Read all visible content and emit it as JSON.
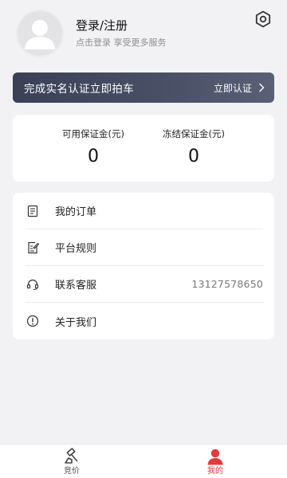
{
  "profile": {
    "title": "登录/注册",
    "subtitle": "点击登录 享受更多服务"
  },
  "verify_banner": {
    "title": "完成实名认证立即拍车",
    "action": "立即认证"
  },
  "deposit": {
    "available_label": "可用保证金(元)",
    "available_value": "0",
    "frozen_label": "冻结保证金(元)",
    "frozen_value": "0"
  },
  "menu": {
    "items": [
      {
        "label": "我的订单",
        "icon": "order-list-icon",
        "value": ""
      },
      {
        "label": "平台规则",
        "icon": "rules-edit-icon",
        "value": ""
      },
      {
        "label": "联系客服",
        "icon": "headset-icon",
        "value": "13127578650"
      },
      {
        "label": "关于我们",
        "icon": "info-icon",
        "value": ""
      }
    ]
  },
  "tabbar": {
    "tabs": [
      {
        "label": "竞价",
        "icon": "gavel-icon",
        "active": false
      },
      {
        "label": "我的",
        "icon": "user-icon",
        "active": true
      }
    ]
  },
  "colors": {
    "accent": "#e23b3b",
    "banner": "#3f465b",
    "background": "#f2f2f4"
  }
}
